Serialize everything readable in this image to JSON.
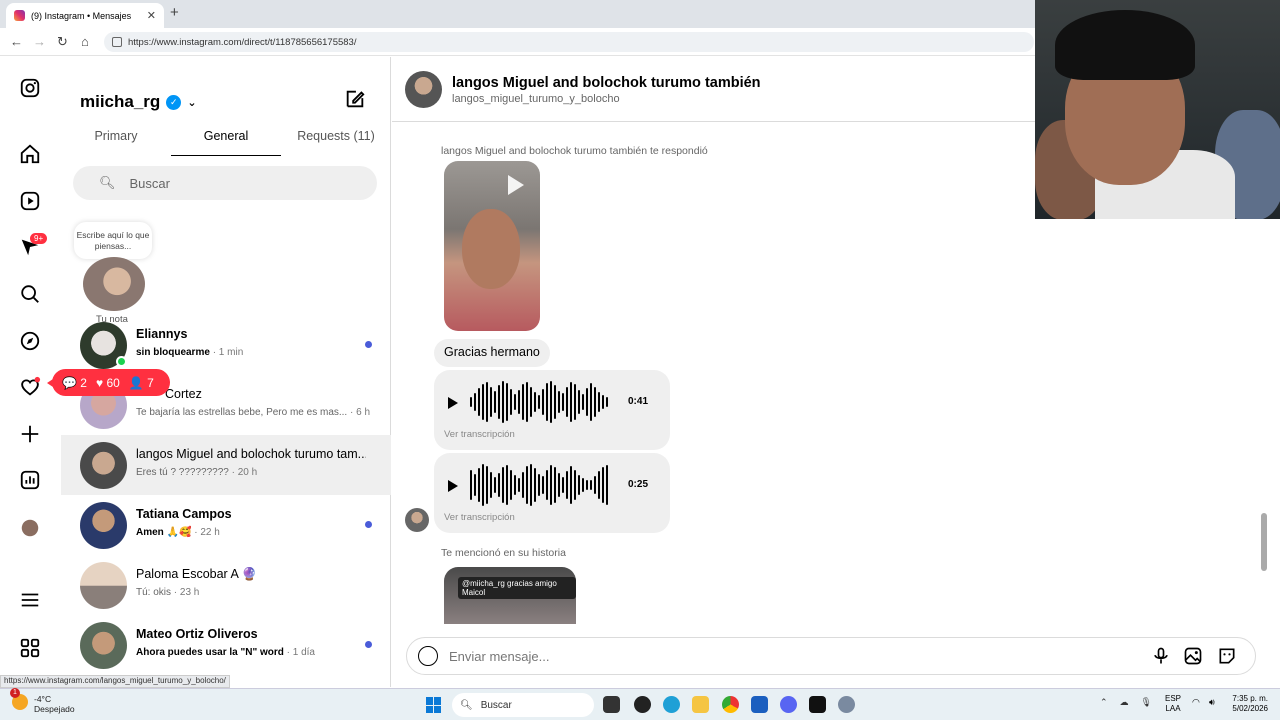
{
  "browser": {
    "tab_title": "(9) Instagram • Mensajes",
    "tab_close": "✕",
    "new_tab": "+",
    "url": "https://www.instagram.com/direct/t/118785656175583/",
    "status_url": "https://www.instagram.com/langos_miguel_turumo_y_bolocho/"
  },
  "rail": {
    "notifications_badge": "9+",
    "pill": {
      "comments": "2",
      "likes": "60",
      "follows": "7"
    }
  },
  "inbox": {
    "username": "miicha_rg",
    "verified_mark": "✓",
    "tabs": {
      "primary": "Primary",
      "general": "General",
      "requests": "Requests (11)"
    },
    "search_placeholder": "Buscar",
    "note_prompt": "Escribe aquí lo que piensas...",
    "note_label": "Tu nota",
    "conversations": [
      {
        "name": "Eliannys",
        "preview": "sin bloquearme",
        "time": "· 1 min",
        "unread": true
      },
      {
        "name": "Cortez",
        "preview": "Te bajaría las estrellas bebe, Pero me es mas...",
        "time": "· 6 h",
        "unread": false
      },
      {
        "name": "langos Miguel and bolochok turumo tam...",
        "preview": "Eres tú ? ?????????",
        "time": "· 20 h",
        "unread": false
      },
      {
        "name": "Tatiana Campos",
        "preview": "Amen 🙏🥰",
        "time": "· 22 h",
        "unread": true
      },
      {
        "name": "Paloma Escobar A 🔮",
        "preview": "Tú: okis",
        "time": "· 23 h",
        "unread": false
      },
      {
        "name": "Mateo Ortiz Oliveros",
        "preview": "Ahora puedes usar la \"N\" word",
        "time": "· 1 día",
        "unread": true
      }
    ]
  },
  "thread": {
    "title": "langos Miguel and bolochok turumo también",
    "handle": "langos_miguel_turumo_y_bolocho",
    "replied_label": "langos Miguel and bolochok turumo también te respondió",
    "text_message": "Gracias hermano",
    "audios": [
      {
        "duration": "0:41",
        "transcript_link": "Ver transcripción"
      },
      {
        "duration": "0:25",
        "transcript_link": "Ver transcripción"
      }
    ],
    "mention_label": "Te mencionó en su historia",
    "story_caption": "@miicha_rg gracias amigo Maicol",
    "composer_placeholder": "Enviar mensaje..."
  },
  "taskbar": {
    "weather_badge": "1",
    "temperature": "-4°C",
    "weather_desc": "Despejado",
    "search_label": "Buscar",
    "lang_line1": "ESP",
    "lang_line2": "LAA",
    "time": "7:35 p. m.",
    "date": "5/02/2026"
  },
  "colors": {
    "accent_blue": "#0095f6",
    "unread_dot": "#4a5cd9",
    "notif_red": "#ff3040"
  }
}
